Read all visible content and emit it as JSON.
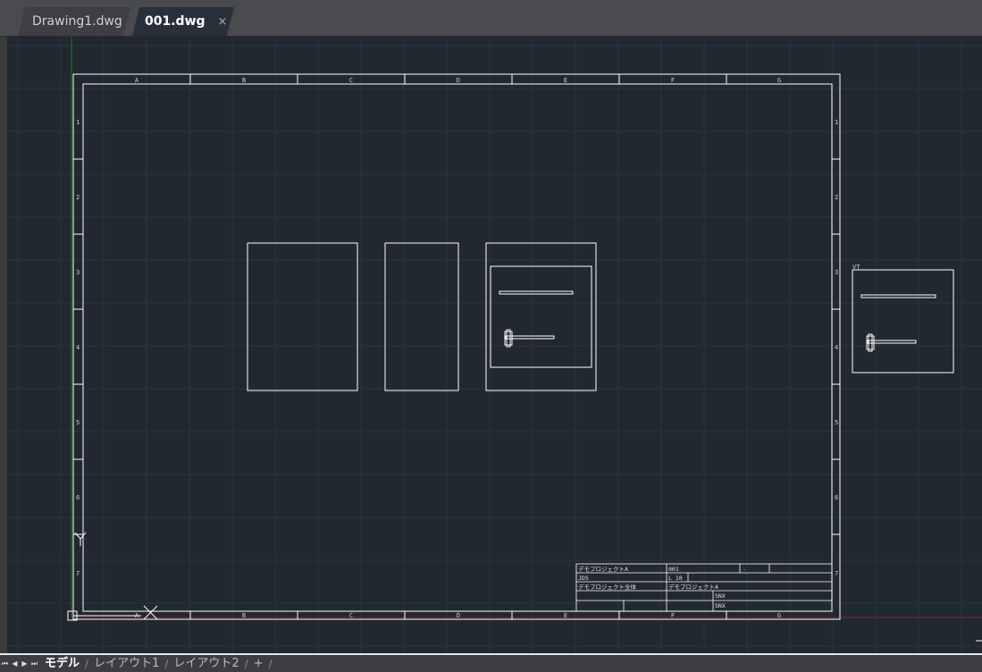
{
  "tabs": {
    "file1": "Drawing1.dwg",
    "file2": "001.dwg",
    "close": "×"
  },
  "layout_tabs": {
    "model": "モデル",
    "layout1": "レイアウト1",
    "layout2": "レイアウト2",
    "add": "+",
    "sep": "/"
  },
  "nav": {
    "first": "⏮",
    "prev": "◀",
    "next": "▶",
    "last": "⏭"
  },
  "colors": {
    "background": "#212830",
    "lines": "#ffffff",
    "grid": "#2c3540",
    "y_axis": "#1f7a2a",
    "x_axis": "#8a1f1f"
  },
  "frame": {
    "columns": [
      "A",
      "B",
      "C",
      "D",
      "E",
      "F",
      "G"
    ],
    "rows": [
      "1",
      "2",
      "3",
      "4",
      "5",
      "6",
      "7"
    ]
  },
  "viewport_label": "VT",
  "title_block": {
    "r1": [
      "デモプロジェクトA",
      "001",
      "-"
    ],
    "r2": [
      "JDS",
      "L 10"
    ],
    "r3": [
      "デモプロジェクト全体",
      "デモプロジェクトA"
    ],
    "r4": [
      "SNX"
    ],
    "r5": [
      "SNX"
    ]
  }
}
